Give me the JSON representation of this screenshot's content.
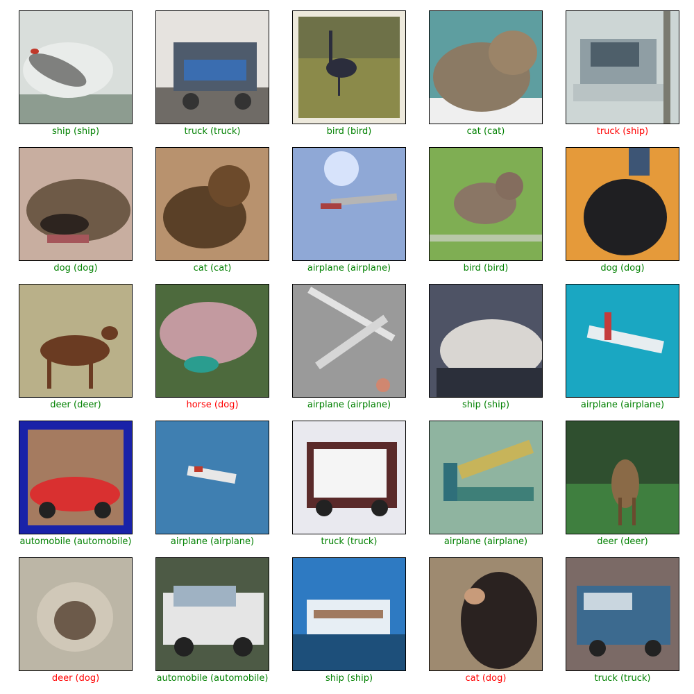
{
  "colors": {
    "correct": "#008000",
    "incorrect": "#ff0000"
  },
  "grid": {
    "items": [
      {
        "label": "ship (ship)",
        "correct": true,
        "subject": "ship"
      },
      {
        "label": "truck (truck)",
        "correct": true,
        "subject": "truck"
      },
      {
        "label": "bird (bird)",
        "correct": true,
        "subject": "bird"
      },
      {
        "label": "cat (cat)",
        "correct": true,
        "subject": "cat"
      },
      {
        "label": "truck (ship)",
        "correct": false,
        "subject": "ship"
      },
      {
        "label": "dog (dog)",
        "correct": true,
        "subject": "dog"
      },
      {
        "label": "cat (cat)",
        "correct": true,
        "subject": "cat"
      },
      {
        "label": "airplane (airplane)",
        "correct": true,
        "subject": "airplane"
      },
      {
        "label": "bird (bird)",
        "correct": true,
        "subject": "bird"
      },
      {
        "label": "dog (dog)",
        "correct": true,
        "subject": "dog"
      },
      {
        "label": "deer (deer)",
        "correct": true,
        "subject": "deer"
      },
      {
        "label": "horse (dog)",
        "correct": false,
        "subject": "dog"
      },
      {
        "label": "airplane (airplane)",
        "correct": true,
        "subject": "airplane"
      },
      {
        "label": "ship (ship)",
        "correct": true,
        "subject": "ship"
      },
      {
        "label": "airplane (airplane)",
        "correct": true,
        "subject": "airplane"
      },
      {
        "label": "automobile (automobile)",
        "correct": true,
        "subject": "automobile"
      },
      {
        "label": "airplane (airplane)",
        "correct": true,
        "subject": "airplane"
      },
      {
        "label": "truck (truck)",
        "correct": true,
        "subject": "truck"
      },
      {
        "label": "airplane (airplane)",
        "correct": true,
        "subject": "airplane"
      },
      {
        "label": "deer (deer)",
        "correct": true,
        "subject": "deer"
      },
      {
        "label": "deer (dog)",
        "correct": false,
        "subject": "dog"
      },
      {
        "label": "automobile (automobile)",
        "correct": true,
        "subject": "automobile"
      },
      {
        "label": "ship (ship)",
        "correct": true,
        "subject": "ship"
      },
      {
        "label": "cat (dog)",
        "correct": false,
        "subject": "dog"
      },
      {
        "label": "truck (truck)",
        "correct": true,
        "subject": "truck"
      }
    ]
  }
}
